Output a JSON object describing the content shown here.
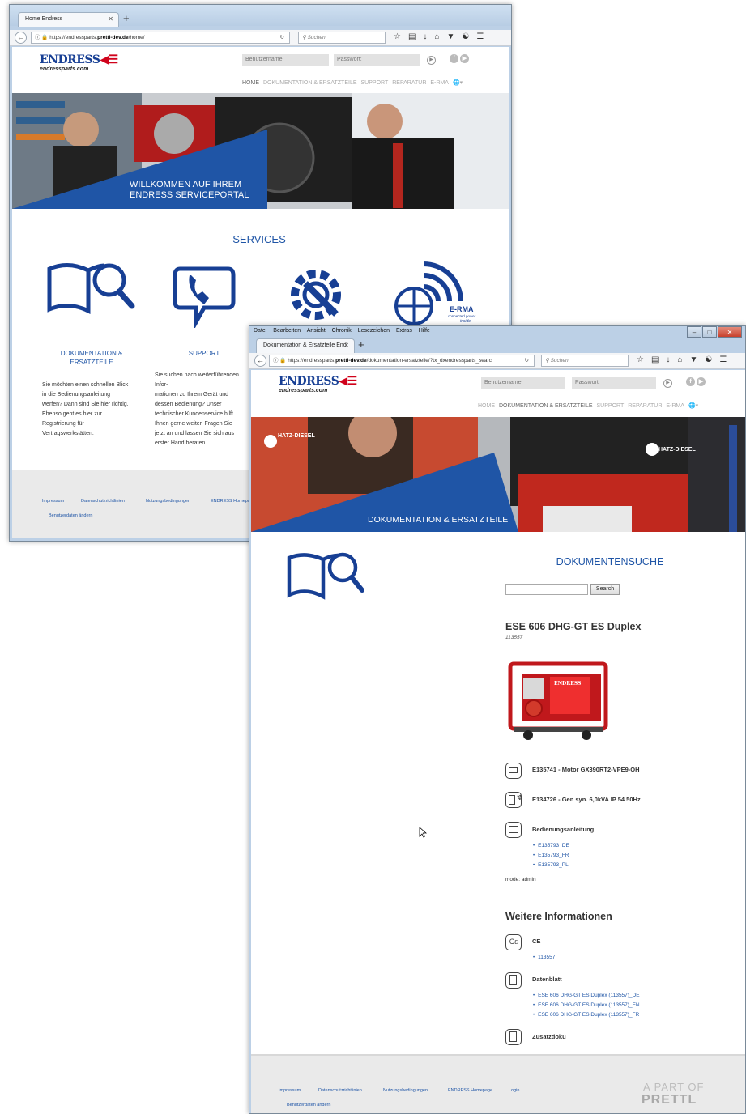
{
  "colors": {
    "brand": "#1f55a6",
    "accent": "#d0021b"
  },
  "win1": {
    "tab_label": "Home Endress",
    "url_prefix": "https://endressparts.",
    "url_domain": "prettl-dev.de",
    "url_path": "/home/",
    "search_placeholder": "Suchen",
    "logo_text": "ENDRESS",
    "logo_sub": "endressparts.com",
    "username_placeholder": "Benutzername:",
    "password_placeholder": "Passwort:",
    "nav": [
      "HOME",
      "DOKUMENTATION & ERSATZTEILE",
      "SUPPORT",
      "REPARATUR",
      "E-RMA"
    ],
    "hero_caption_1": "WILLKOMMEN AUF IHREM",
    "hero_caption_2": "ENDRESS SERVICEPORTAL",
    "services_title": "SERVICES",
    "services": [
      {
        "head": "DOKUMENTATION &",
        "head2": "ERSATZTEILE",
        "text": [
          "Sie möchten einen schnellen Blick",
          "in die Bedienungsanleitung",
          "werfen? Dann sind Sie hier richtig.",
          "Ebenso geht es hier zur",
          "Registrierung für",
          "Vertragswerkstätten."
        ]
      },
      {
        "head": "SUPPORT",
        "head2": "",
        "text": [
          "Sie suchen nach weiterführenden",
          "Infor-",
          "mationen zu Ihrem Gerät und",
          "dessen Bedienung? Unser",
          "technischer Kundenservice hilft",
          "Ihnen gerne weiter. Fragen Sie",
          "jetzt an und lassen Sie sich aus",
          "erster Hand beraten."
        ]
      }
    ],
    "erma_label": "E-RMA",
    "erma_sub1": "connected power",
    "erma_sub2": "inside",
    "footer_links": [
      "Impressum",
      "Datenschutzrichtlinien",
      "Nutzungsbedingungen",
      "ENDRESS Homepage"
    ],
    "footer_link2": "Benutzerdaten ändern"
  },
  "win2": {
    "menu": [
      "Datei",
      "Bearbeiten",
      "Ansicht",
      "Chronik",
      "Lesezeichen",
      "Extras",
      "Hilfe"
    ],
    "tab_label": "Dokumentation & Ersatzteile End",
    "url_prefix": "https://endressparts.",
    "url_domain": "prettl-dev.de",
    "url_path": "/dokumentation-ersatzteile/?tx_dxendressparts_searc",
    "search_placeholder": "Suchen",
    "logo_text": "ENDRESS",
    "logo_sub": "endressparts.com",
    "username_placeholder": "Benutzername:",
    "password_placeholder": "Passwort:",
    "nav": [
      "HOME",
      "DOKUMENTATION & ERSATZTEILE",
      "SUPPORT",
      "REPARATUR",
      "E-RMA"
    ],
    "hero_caption": "DOKUMENTATION & ERSATZTEILE",
    "hatz_label": "HATZ-DIESEL",
    "doc_search_title": "DOKUMENTENSUCHE",
    "search_button": "Search",
    "product_title": "ESE 606 DHG-GT ES Duplex",
    "product_number": "113557",
    "gen_label": "ENDRESS",
    "part1": "E135741 - Motor GX390RT2-VPE9-OH",
    "part2": "E134726 - Gen syn. 6,0kVA IP 54 50Hz",
    "manual_label": "Bedienungsanleitung",
    "manual_links": [
      "E135793_DE",
      "E135793_FR",
      "E135793_PL"
    ],
    "mode": "mode: admin",
    "weitere": "Weitere Informationen",
    "ce_label": "CE",
    "ce_links": [
      "113557"
    ],
    "datenblatt_label": "Datenblatt",
    "datenblatt_links": [
      "ESE 606 DHG-GT ES Duplex (113557)_DE",
      "ESE 606 DHG-GT ES Duplex (113557)_EN",
      "ESE 606 DHG-GT ES Duplex (113557)_FR"
    ],
    "zusatz_label": "Zusatzdoku",
    "footer_links": [
      "Impressum",
      "Datenschutzrichtlinien",
      "Nutzungsbedingungen",
      "ENDRESS Homepage",
      "Login"
    ],
    "footer_link2": "Benutzerdaten ändern",
    "prettl_line1": "A PART OF",
    "prettl_line2": "PRETTL"
  }
}
